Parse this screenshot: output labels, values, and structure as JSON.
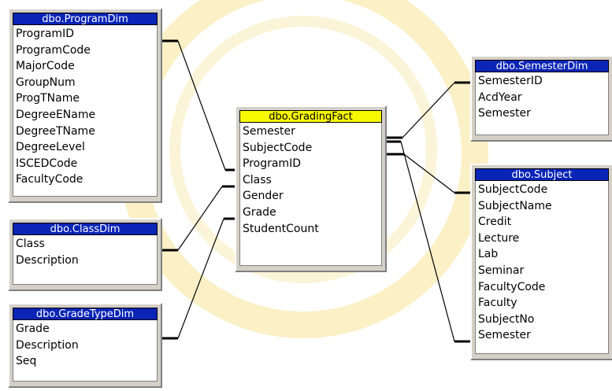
{
  "tables": {
    "program": {
      "title": "dbo.ProgramDim",
      "fields": [
        "ProgramID",
        "ProgramCode",
        "MajorCode",
        "GroupNum",
        "ProgTName",
        "DegreeEName",
        "DegreeTName",
        "DegreeLevel",
        "ISCEDCode",
        "FacultyCode"
      ]
    },
    "class": {
      "title": "dbo.ClassDim",
      "fields": [
        "Class",
        "Description"
      ]
    },
    "gradetype": {
      "title": "dbo.GradeTypeDim",
      "fields": [
        "Grade",
        "Description",
        "Seq"
      ]
    },
    "fact": {
      "title": "dbo.GradingFact",
      "fields": [
        "Semester",
        "SubjectCode",
        "ProgramID",
        "Class",
        "Gender",
        "Grade",
        "StudentCount"
      ]
    },
    "semester": {
      "title": "dbo.SemesterDim",
      "fields": [
        "SemesterID",
        "AcdYear",
        "Semester"
      ]
    },
    "subject": {
      "title": "dbo.Subject",
      "fields": [
        "SubjectCode",
        "SubjectName",
        "Credit",
        "Lecture",
        "Lab",
        "Seminar",
        "FacultyCode",
        "Faculty",
        "SubjectNo",
        "Semester"
      ]
    }
  },
  "colors": {
    "title_bar": "#0a24b6",
    "fact_title_bar": "#f8f800",
    "panel": "#d4d0c8"
  }
}
